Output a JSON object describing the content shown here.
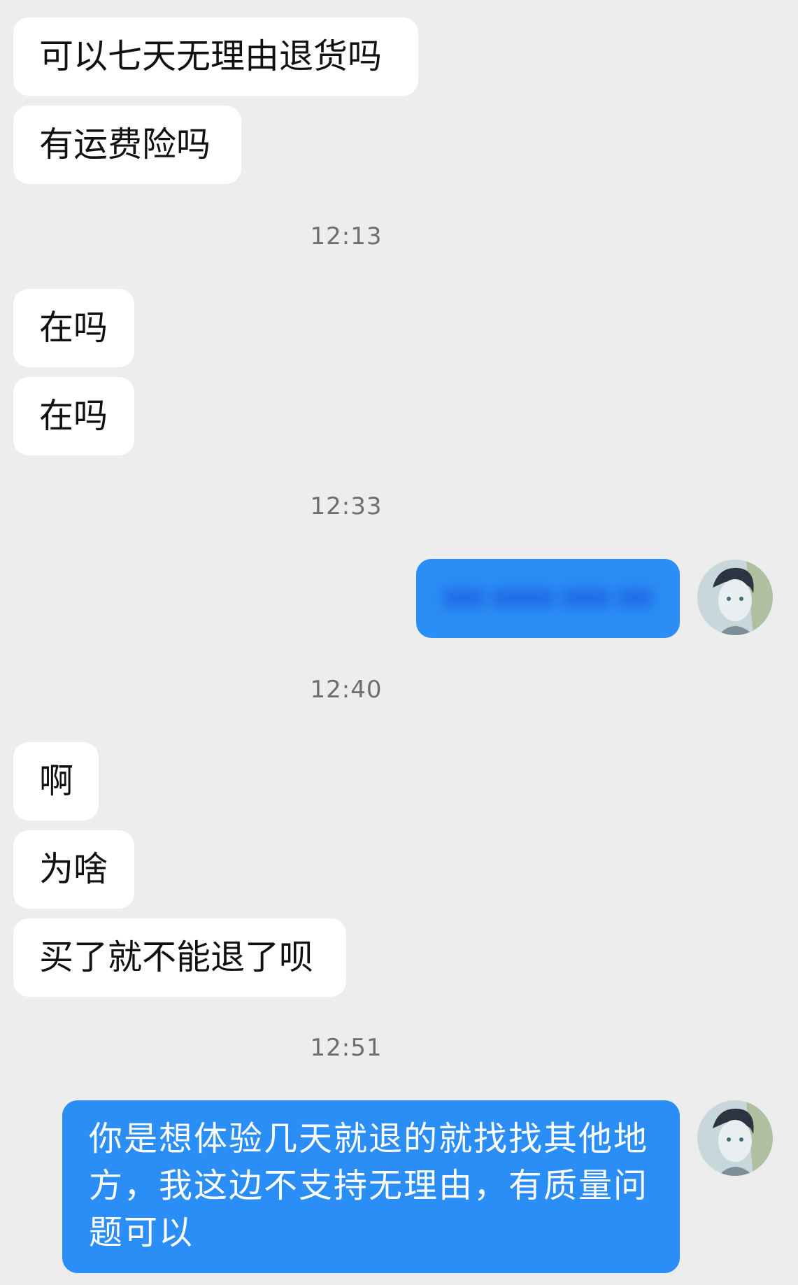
{
  "messages": {
    "m1": "可以七天无理由退货吗",
    "m2": "有运费险吗",
    "t1": "12:13",
    "m3": "在吗",
    "m4": "在吗",
    "t2": "12:33",
    "t3": "12:40",
    "m5": "啊",
    "m6": "为啥",
    "m7": "买了就不能退了呗",
    "t4": "12:51",
    "m8": "你是想体验几天就退的就找找其他地方，我这边不支持无理由，有质量问题可以"
  },
  "colors": {
    "background": "#ededed",
    "incoming_bubble": "#ffffff",
    "outgoing_bubble": "#2b8df6"
  },
  "icons": {
    "avatar": "user-avatar-icon"
  }
}
